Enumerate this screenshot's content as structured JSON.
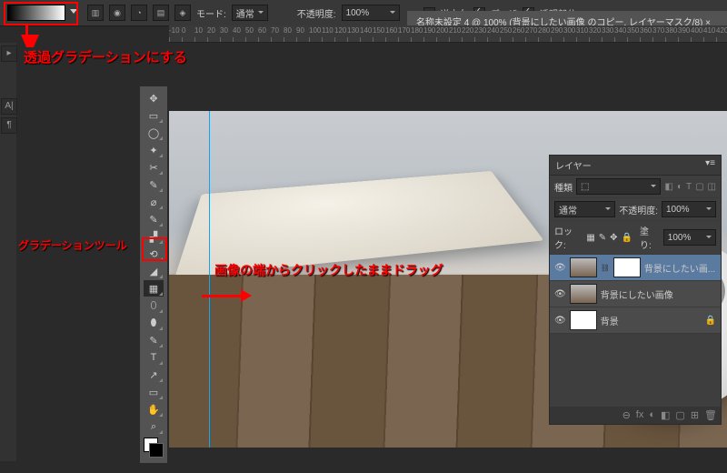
{
  "options_bar": {
    "mode_label": "モード:",
    "mode_value": "通常",
    "opacity_label": "不透明度:",
    "opacity_value": "100%",
    "reverse": "逆方向",
    "dither": "ディザ",
    "transparency": "透明部分"
  },
  "document_tab": "名称未設定 4 @ 100% (背景にしたい画像 のコピー, レイヤーマスク/8) ×",
  "ruler_marks": [
    "-10",
    "0",
    "10",
    "20",
    "30",
    "40",
    "50",
    "60",
    "70",
    "80",
    "90",
    "100",
    "110",
    "120",
    "130",
    "140",
    "150",
    "160",
    "170",
    "180",
    "190",
    "200",
    "210",
    "220",
    "230",
    "240",
    "250",
    "260",
    "270",
    "280",
    "290",
    "300",
    "310",
    "320",
    "330",
    "340",
    "350",
    "360",
    "370",
    "380",
    "390",
    "400",
    "410",
    "420"
  ],
  "layers_panel": {
    "title": "レイヤー",
    "kind_label": "種類",
    "blend": "通常",
    "opacity_label": "不透明度:",
    "opacity_value": "100%",
    "lock_label": "ロック:",
    "fill_label": "塗り:",
    "fill_value": "100%",
    "items": [
      {
        "name": "背景にしたい画...",
        "selected": true,
        "has_mask": true
      },
      {
        "name": "背景にしたい画像",
        "selected": false,
        "has_mask": false
      },
      {
        "name": "背景",
        "selected": false,
        "has_mask": false
      }
    ],
    "footer_icons": [
      "⊖",
      "fx",
      "◐",
      "◧",
      "▢",
      "⊞",
      "🗑"
    ]
  },
  "annotations": {
    "top": "透過グラデーションにする",
    "left": "グラデーションツール",
    "center": "画像の端からクリックしたままドラッグ"
  },
  "tools": [
    "↔",
    "▭",
    "◌",
    "✦",
    "⌕",
    "✂",
    "✎",
    "⌁",
    "▞",
    "◢",
    "✎",
    "T",
    "↗",
    "▭",
    "✋",
    "⌕"
  ]
}
